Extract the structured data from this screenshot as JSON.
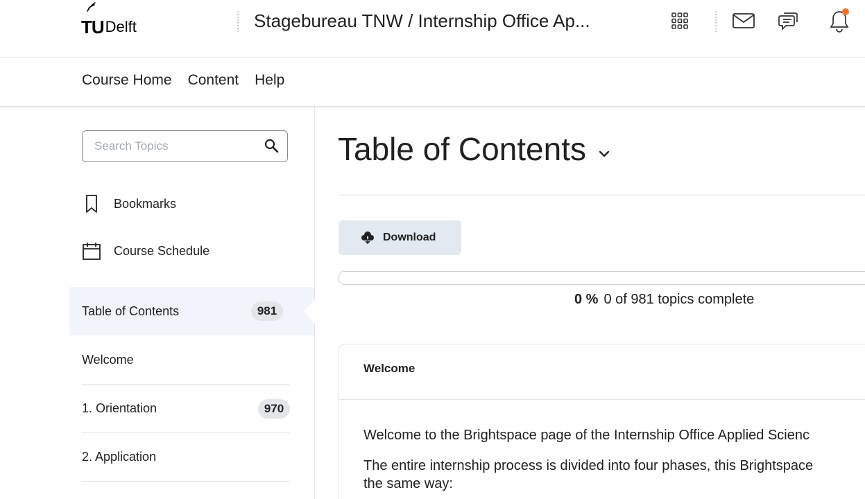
{
  "brand": {
    "logo_tu": "TU",
    "logo_delft": "Delft",
    "logo_text": "TUDelft"
  },
  "header": {
    "course_title": "Stagebureau TNW / Internship Office Ap...",
    "icons": [
      "app-grid-icon",
      "mail-icon",
      "chat-icon",
      "bell-icon"
    ],
    "notification_color": "#f07425"
  },
  "nav": {
    "items": [
      "Course Home",
      "Content",
      "Help"
    ]
  },
  "sidebar": {
    "search_placeholder": "Search Topics",
    "links": [
      {
        "label": "Bookmarks",
        "icon": "bookmark-icon"
      },
      {
        "label": "Course Schedule",
        "icon": "calendar-icon"
      }
    ],
    "toc": [
      {
        "label": "Table of Contents",
        "count": "981",
        "active": true
      },
      {
        "label": "Welcome",
        "count": ""
      },
      {
        "label": "1. Orientation",
        "count": "970"
      },
      {
        "label": "2. Application",
        "count": ""
      }
    ]
  },
  "main": {
    "title": "Table of Contents",
    "download_label": "Download",
    "progress": {
      "percent": "0 %",
      "text": "0 of 981 topics complete",
      "fraction": 0
    },
    "card": {
      "title": "Welcome",
      "paragraphs": [
        "Welcome to the Brightspace page of the Internship Office Applied Scienc",
        "The entire internship process is divided into four phases, this Brightspace",
        "the same way:"
      ]
    }
  },
  "colors": {
    "accent": "#006fbf",
    "active_bg": "#f1f5fb",
    "badge_bg": "#e3e5e8",
    "download_bg": "#e3e9f1"
  }
}
